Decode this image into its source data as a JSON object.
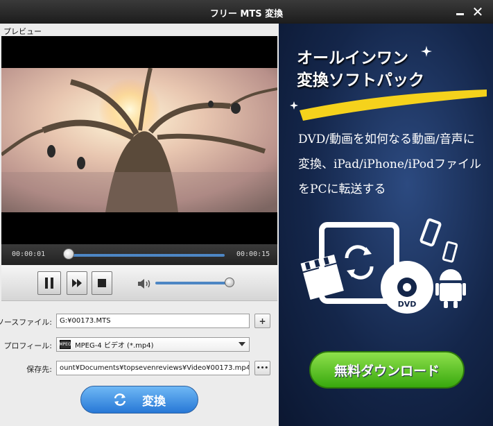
{
  "window": {
    "title": "フリー MTS 変換",
    "minimize_icon": "minimize-icon",
    "close_label": "✕"
  },
  "preview": {
    "label": "プレビュー",
    "time_current": "00:00:01",
    "time_total": "00:00:15",
    "seek_position": 0.03,
    "volume_level": 1.0
  },
  "form": {
    "source_label": "ソースファイル:",
    "source_value": "G:¥00173.MTS",
    "add_button": "+",
    "profile_label": "プロフィール:",
    "profile_value": "MPEG-4 ビデオ (*.mp4)",
    "profile_badge": "MPEG",
    "save_label": "保存先:",
    "save_value": "ount¥Documents¥topsevenreviews¥Video¥00173.mp4",
    "browse_button": "•••"
  },
  "convert": {
    "label": "変換"
  },
  "ad": {
    "title_line1": "オールインワン",
    "title_line2": "変換ソフトパック",
    "desc_line1": "DVD/動画を如何なる動画/音声に",
    "desc_line2": "変換、iPad/iPhone/iPodファイル",
    "desc_line3": "をPCに転送する",
    "dvd_label": "DVD",
    "download_label": "無料ダウンロード"
  },
  "colors": {
    "accent": "#4d86c4",
    "download": "#5cc427",
    "convert": "#2f86e0"
  }
}
